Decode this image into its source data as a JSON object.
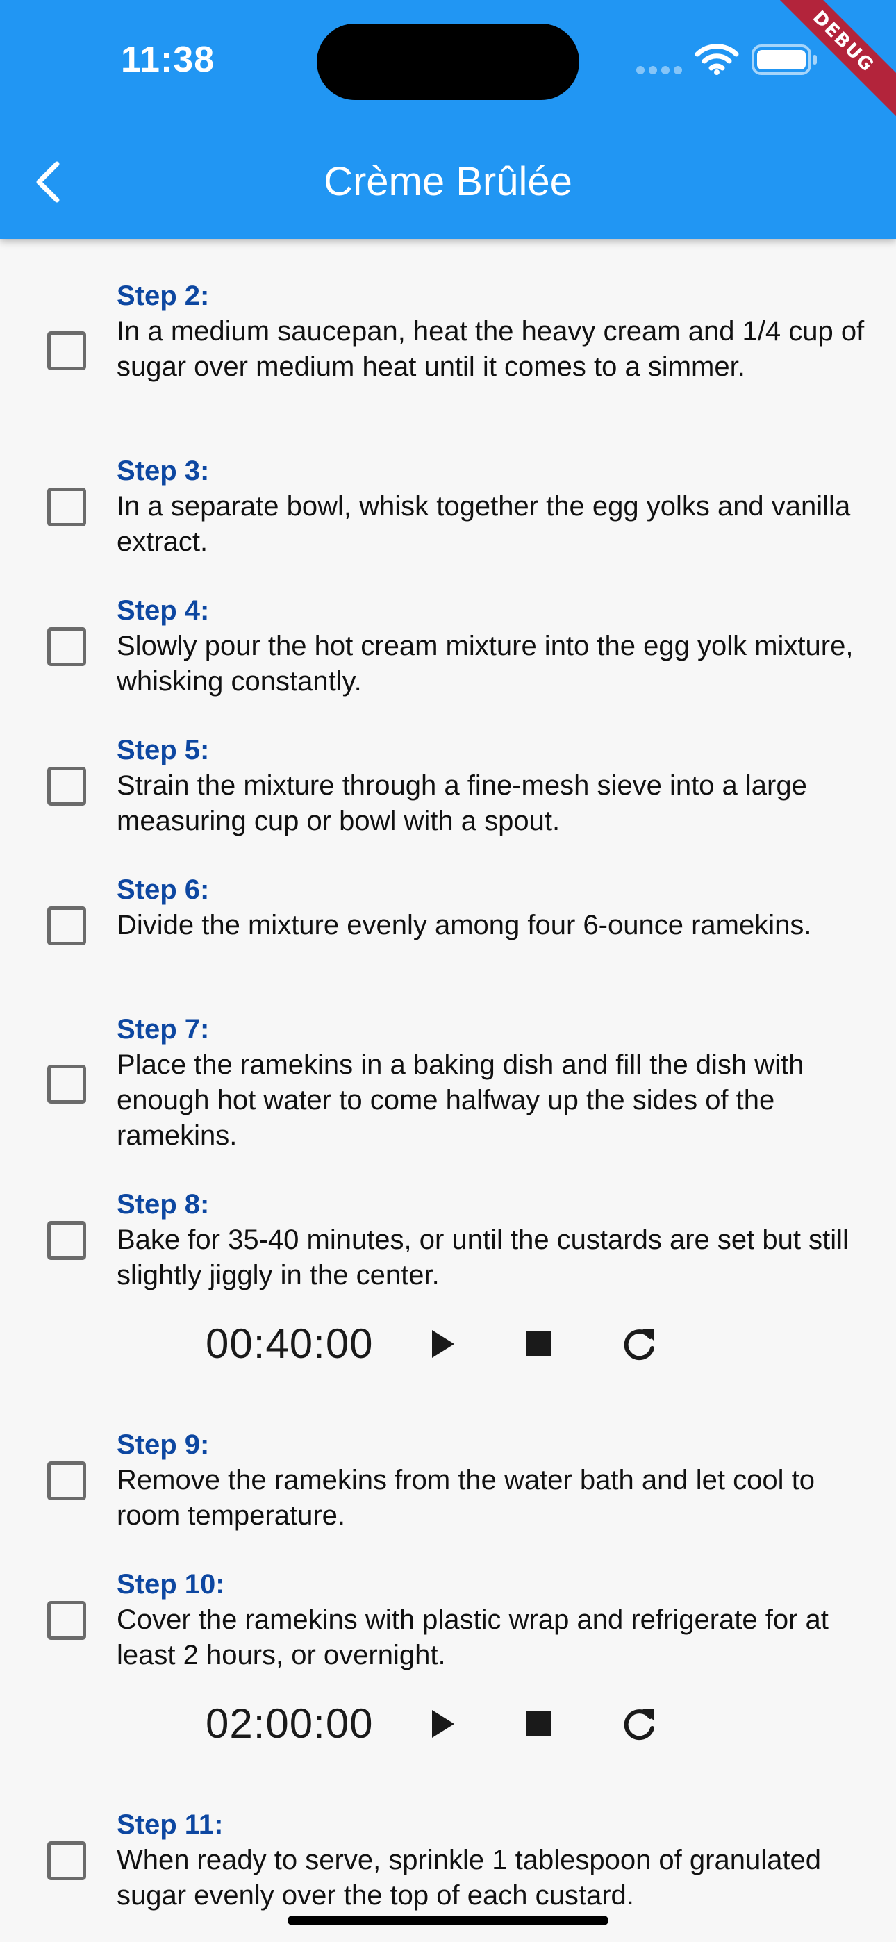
{
  "status_bar": {
    "time": "11:38"
  },
  "debug_banner": "DEBUG",
  "app_bar": {
    "title": "Crème Brûlée",
    "back_icon": "chevron-left-icon",
    "background_color": "#2196f3"
  },
  "colors": {
    "step_title": "#0d47a1",
    "text": "#111111",
    "checkbox_border": "#6b6b6b"
  },
  "steps": [
    {
      "title": "Step 2:",
      "text": "In a medium saucepan, heat the heavy cream and 1/4 cup of sugar over medium heat until it comes to a simmer.",
      "checked": false
    },
    {
      "title": "Step 3:",
      "text": "In a separate bowl, whisk together the egg yolks and vanilla extract.",
      "checked": false
    },
    {
      "title": "Step 4:",
      "text": "Slowly pour the hot cream mixture into the egg yolk mixture, whisking constantly.",
      "checked": false
    },
    {
      "title": "Step 5:",
      "text": "Strain the mixture through a fine-mesh sieve into a large measuring cup or bowl with a spout.",
      "checked": false
    },
    {
      "title": "Step 6:",
      "text": "Divide the mixture evenly among four 6-ounce ramekins.",
      "checked": false
    },
    {
      "title": "Step 7:",
      "text": "Place the ramekins in a baking dish and fill the dish with enough hot water to come halfway up the sides of the ramekins.",
      "checked": false
    },
    {
      "title": "Step 8:",
      "text": "Bake for 35-40 minutes, or until the custards are set but still slightly jiggly in the center.",
      "checked": false,
      "timer": "00:40:00"
    },
    {
      "title": "Step 9:",
      "text": "Remove the ramekins from the water bath and let cool to room temperature.",
      "checked": false
    },
    {
      "title": "Step 10:",
      "text": "Cover the ramekins with plastic wrap and refrigerate for at least 2 hours, or overnight.",
      "checked": false,
      "timer": "02:00:00"
    },
    {
      "title": "Step 11:",
      "text": "When ready to serve, sprinkle 1 tablespoon of granulated sugar evenly over the top of each custard.",
      "checked": false
    }
  ],
  "timer_controls": {
    "play_icon": "play-icon",
    "stop_icon": "stop-icon",
    "reset_icon": "refresh-icon"
  }
}
